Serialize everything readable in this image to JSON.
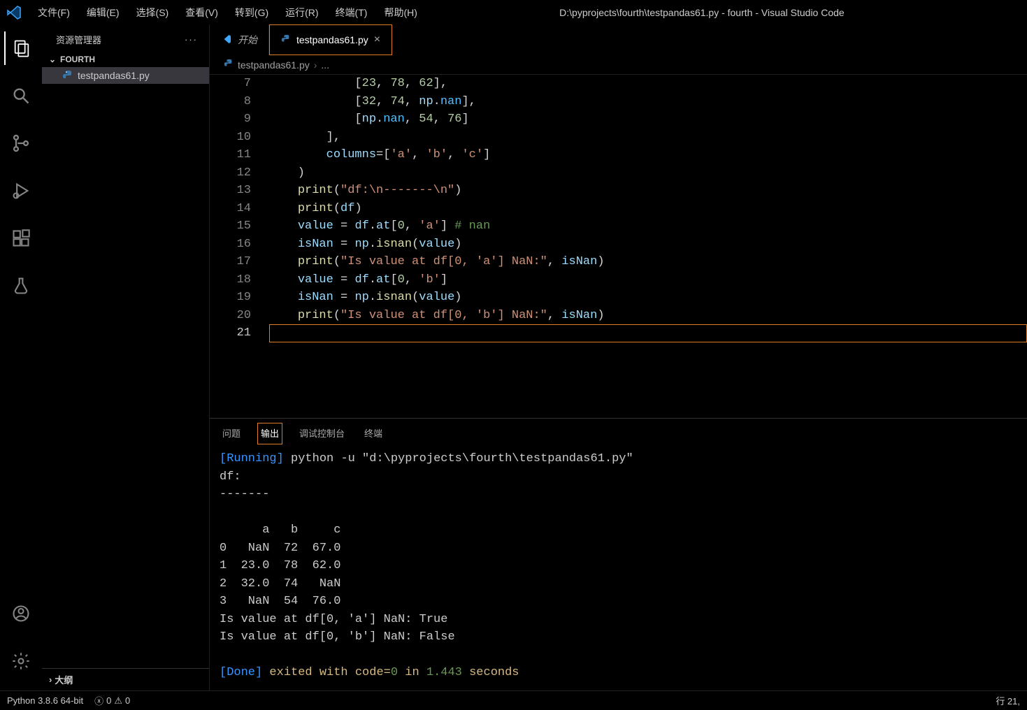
{
  "window": {
    "title": "D:\\pyprojects\\fourth\\testpandas61.py - fourth - Visual Studio Code"
  },
  "menu": {
    "file": "文件(F)",
    "edit": "编辑(E)",
    "select": "选择(S)",
    "view": "查看(V)",
    "goto": "转到(G)",
    "run": "运行(R)",
    "terminal": "终端(T)",
    "help": "帮助(H)"
  },
  "sidebar": {
    "title": "资源管理器",
    "project": "FOURTH",
    "file0": "testpandas61.py",
    "outline": "大纲"
  },
  "tabs": {
    "start": "开始",
    "active": "testpandas61.py"
  },
  "breadcrumb": {
    "file": "testpandas61.py",
    "more": "..."
  },
  "code": {
    "lines": {
      "7": "            [23, 78, 62],",
      "8": "            [32, 74, np.nan],",
      "9": "            [np.nan, 54, 76]",
      "10": "        ],",
      "11": "        columns=['a', 'b', 'c']",
      "12": "    )",
      "13": "    print(\"df:\\n-------\\n\")",
      "14": "    print(df)",
      "15": "    value = df.at[0, 'a'] # nan",
      "16": "    isNan = np.isnan(value)",
      "17": "    print(\"Is value at df[0, 'a'] NaN:\", isNan)",
      "18": "    value = df.at[0, 'b']",
      "19": "    isNan = np.isnan(value)",
      "20": "    print(\"Is value at df[0, 'b'] NaN:\", isNan)",
      "21": ""
    }
  },
  "panel": {
    "tabs": {
      "problems": "问题",
      "output": "输出",
      "debug": "调试控制台",
      "terminal": "终端"
    },
    "output": {
      "running_tag": "[Running]",
      "running_cmd": " python -u \"d:\\pyprojects\\fourth\\testpandas61.py\"",
      "body": "df:\n-------\n\n      a   b     c\n0   NaN  72  67.0\n1  23.0  78  62.0\n2  32.0  74   NaN\n3   NaN  54  76.0\nIs value at df[0, 'a'] NaN: True\nIs value at df[0, 'b'] NaN: False\n",
      "done_tag": "[Done]",
      "done_msg_1": " exited with ",
      "done_code_label": "code=",
      "done_code_val": "0",
      "done_msg_2": " in ",
      "done_time": "1.443",
      "done_msg_3": " seconds"
    }
  },
  "status": {
    "python": "Python 3.8.6 64-bit",
    "errors": "0",
    "warnings": "0",
    "position": "行 21,"
  }
}
